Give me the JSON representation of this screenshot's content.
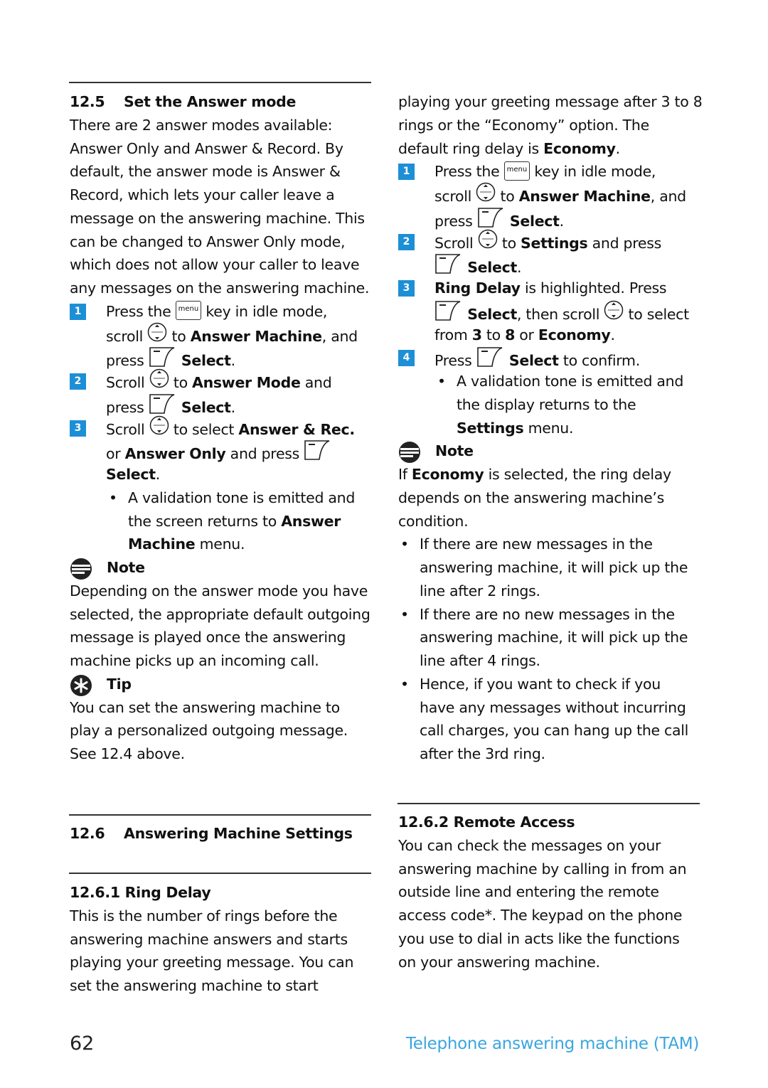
{
  "icons": {
    "menu_key_label": "menu",
    "colors": {
      "step_badge": "#1d8fd6",
      "footer": "#3aa6df"
    }
  },
  "left_top": [
    {
      "k": "heading",
      "num": "12.5",
      "title": "Set the Answer mode"
    },
    {
      "k": "p",
      "s": [
        "There are 2 answer modes available:"
      ]
    },
    {
      "k": "p",
      "s": [
        "Answer Only and Answer & Record. By"
      ]
    },
    {
      "k": "p",
      "s": [
        "default, the answer mode is Answer &"
      ]
    },
    {
      "k": "p",
      "s": [
        "Record, which lets your caller leave a"
      ]
    },
    {
      "k": "p",
      "s": [
        "message on the answering machine. This"
      ]
    },
    {
      "k": "p",
      "s": [
        "can be changed to Answer Only mode,"
      ]
    },
    {
      "k": "p",
      "s": [
        "which does not allow your caller to leave"
      ]
    },
    {
      "k": "p",
      "s": [
        "any messages on the answering machine."
      ]
    },
    {
      "k": "step",
      "n": "1",
      "s": [
        "Press the ",
        {
          "i": "menu"
        },
        " key in idle mode,"
      ]
    },
    {
      "k": "cont",
      "s": [
        "scroll ",
        {
          "i": "scroll"
        },
        " to ",
        {
          "b": "Answer Machine"
        },
        ", and"
      ]
    },
    {
      "k": "cont",
      "s": [
        "press ",
        {
          "i": "select"
        },
        " ",
        {
          "b": "Select"
        },
        "."
      ]
    },
    {
      "k": "step",
      "n": "2",
      "s": [
        "Scroll ",
        {
          "i": "scroll"
        },
        " to ",
        {
          "b": "Answer Mode"
        },
        " and"
      ]
    },
    {
      "k": "cont",
      "s": [
        "press ",
        {
          "i": "select"
        },
        " ",
        {
          "b": "Select"
        },
        "."
      ]
    },
    {
      "k": "step",
      "n": "3",
      "s": [
        "Scroll ",
        {
          "i": "scroll"
        },
        " to select ",
        {
          "b": "Answer & Rec."
        }
      ]
    },
    {
      "k": "cont",
      "s": [
        "or ",
        {
          "b": "Answer Only"
        },
        " and press ",
        {
          "i": "select"
        }
      ]
    },
    {
      "k": "cont",
      "s": [
        {
          "b": "Select"
        },
        "."
      ]
    },
    {
      "k": "sub",
      "s": [
        "A validation tone is emitted and"
      ]
    },
    {
      "k": "subc",
      "s": [
        "the screen returns to ",
        {
          "b": "Answer"
        }
      ]
    },
    {
      "k": "subc",
      "s": [
        {
          "b": "Machine"
        },
        " menu."
      ]
    },
    {
      "k": "note",
      "s": [
        "Note"
      ]
    },
    {
      "k": "p",
      "s": [
        "Depending on the answer mode you have"
      ]
    },
    {
      "k": "p",
      "s": [
        "selected, the appropriate default outgoing"
      ]
    },
    {
      "k": "p",
      "s": [
        "message is played once the answering"
      ]
    },
    {
      "k": "p",
      "s": [
        "machine picks up an incoming call."
      ]
    },
    {
      "k": "tip",
      "s": [
        "Tip"
      ]
    },
    {
      "k": "p",
      "s": [
        "You can set the answering machine to"
      ]
    },
    {
      "k": "p",
      "s": [
        "play a personalized outgoing message."
      ]
    },
    {
      "k": "p",
      "s": [
        "See 12.4 above."
      ]
    }
  ],
  "right_top": [
    {
      "k": "p",
      "s": [
        "playing your greeting message after 3 to 8"
      ]
    },
    {
      "k": "p",
      "s": [
        "rings or the “Economy” option. The"
      ]
    },
    {
      "k": "p",
      "s": [
        "default ring delay is ",
        {
          "b": "Economy"
        },
        "."
      ]
    },
    {
      "k": "step",
      "n": "1",
      "s": [
        "Press the ",
        {
          "i": "menu"
        },
        " key in idle mode,"
      ]
    },
    {
      "k": "cont",
      "s": [
        "scroll ",
        {
          "i": "scroll"
        },
        " to ",
        {
          "b": "Answer Machine"
        },
        ", and"
      ]
    },
    {
      "k": "cont",
      "s": [
        "press ",
        {
          "i": "select"
        },
        " ",
        {
          "b": "Select"
        },
        "."
      ]
    },
    {
      "k": "step",
      "n": "2",
      "s": [
        "Scroll ",
        {
          "i": "scroll"
        },
        " to ",
        {
          "b": "Settings"
        },
        " and press"
      ]
    },
    {
      "k": "cont",
      "s": [
        {
          "i": "select"
        },
        " ",
        {
          "b": "Select"
        },
        "."
      ]
    },
    {
      "k": "step",
      "n": "3",
      "s": [
        {
          "b": "Ring Delay"
        },
        " is highlighted. Press"
      ]
    },
    {
      "k": "cont",
      "s": [
        {
          "i": "select"
        },
        " ",
        {
          "b": "Select"
        },
        ", then scroll ",
        {
          "i": "scroll"
        },
        " to select"
      ]
    },
    {
      "k": "cont",
      "s": [
        "from ",
        {
          "b": "3"
        },
        " to ",
        {
          "b": "8"
        },
        " or ",
        {
          "b": "Economy"
        },
        "."
      ]
    },
    {
      "k": "step",
      "n": "4",
      "s": [
        "Press ",
        {
          "i": "select"
        },
        " ",
        {
          "b": "Select"
        },
        " to confirm."
      ]
    },
    {
      "k": "sub",
      "s": [
        "A validation tone is emitted and"
      ]
    },
    {
      "k": "subc",
      "s": [
        "the display returns to the"
      ]
    },
    {
      "k": "subc",
      "s": [
        {
          "b": "Settings"
        },
        " menu."
      ]
    },
    {
      "k": "note",
      "s": [
        "Note"
      ]
    },
    {
      "k": "p",
      "s": [
        "If ",
        {
          "b": "Economy"
        },
        " is selected, the ring delay"
      ]
    },
    {
      "k": "p",
      "s": [
        "depends on the answering machine’s"
      ]
    },
    {
      "k": "p",
      "s": [
        "condition."
      ]
    },
    {
      "k": "bul",
      "s": [
        "If there are new messages in the"
      ]
    },
    {
      "k": "bulc",
      "s": [
        "answering machine, it will pick up the"
      ]
    },
    {
      "k": "bulc",
      "s": [
        "line after 2 rings."
      ]
    },
    {
      "k": "bul",
      "s": [
        "If there are no new messages in the"
      ]
    },
    {
      "k": "bulc",
      "s": [
        "answering machine, it will pick up the"
      ]
    },
    {
      "k": "bulc",
      "s": [
        "line after 4 rings."
      ]
    },
    {
      "k": "bul",
      "s": [
        "Hence, if you want to check if you"
      ]
    },
    {
      "k": "bulc",
      "s": [
        "have any messages without incurring"
      ]
    },
    {
      "k": "bulc",
      "s": [
        "call charges, you can hang up the call"
      ]
    },
    {
      "k": "bulc",
      "s": [
        "after the 3rd ring."
      ]
    }
  ],
  "left_section": [
    {
      "k": "heading",
      "num": "12.6",
      "title": "Answering Machine Settings"
    }
  ],
  "left_bottom": [
    {
      "k": "heading",
      "num": "",
      "title": "12.6.1 Ring Delay"
    },
    {
      "k": "p",
      "s": [
        "This is the number of rings before the"
      ]
    },
    {
      "k": "p",
      "s": [
        "answering machine answers and starts"
      ]
    },
    {
      "k": "p",
      "s": [
        "playing your greeting message. You can"
      ]
    },
    {
      "k": "p",
      "s": [
        "set the answering machine to start"
      ]
    }
  ],
  "right_bottom": [
    {
      "k": "heading",
      "num": "",
      "title": "12.6.2 Remote Access"
    },
    {
      "k": "p",
      "s": [
        "You can check the messages on your"
      ]
    },
    {
      "k": "p",
      "s": [
        "answering machine by calling in from an"
      ]
    },
    {
      "k": "p",
      "s": [
        "outside line and entering the remote"
      ]
    },
    {
      "k": "p",
      "s": [
        "access code*. The keypad on the phone"
      ]
    },
    {
      "k": "p",
      "s": [
        "you use to dial in acts like the functions"
      ]
    },
    {
      "k": "p",
      "s": [
        "on your answering machine."
      ]
    }
  ],
  "footer": {
    "page_number": "62",
    "chapter_title": "Telephone answering machine (TAM)"
  }
}
